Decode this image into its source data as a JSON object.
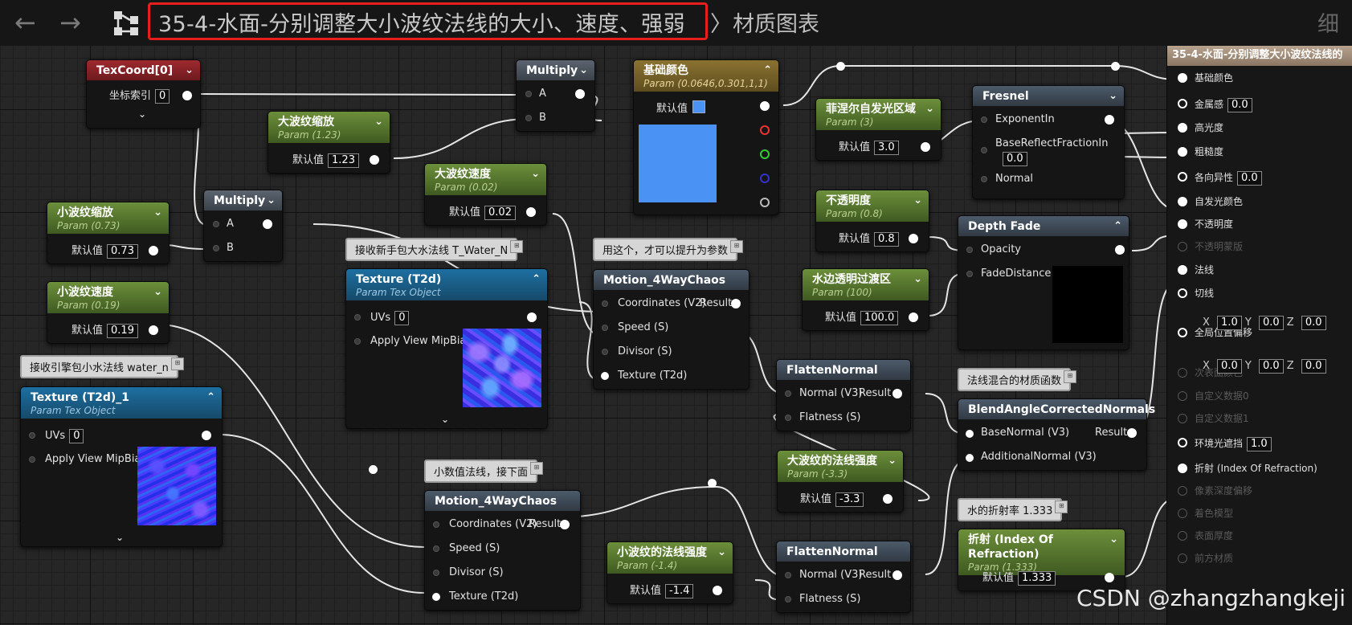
{
  "toolbar": {
    "back_arrow": "←",
    "forward_arrow": "→",
    "graph_title": "35-4-水面-分别调整大小波纹法线的大小、速度、强弱",
    "breadcrumb_separator": "〉",
    "breadcrumb_next": "材质图表",
    "breadcrumb_tail": "细"
  },
  "nodes": {
    "texcoord": {
      "title": "TexCoord[0]",
      "row_label": "坐标索引",
      "value": "0"
    },
    "multiply1": {
      "title": "Multiply",
      "pin_a": "A",
      "pin_b": "B"
    },
    "multiply2": {
      "title": "Multiply",
      "pin_a": "A",
      "pin_b": "B"
    },
    "big_ripple_scale": {
      "title": "大波纹缩放",
      "subtitle": "Param (1.23)",
      "label": "默认值",
      "value": "1.23"
    },
    "big_ripple_speed": {
      "title": "大波纹速度",
      "subtitle": "Param (0.02)",
      "label": "默认值",
      "value": "0.02"
    },
    "small_ripple_scale": {
      "title": "小波纹缩放",
      "subtitle": "Param (0.73)",
      "label": "默认值",
      "value": "0.73"
    },
    "small_ripple_speed": {
      "title": "小波纹速度",
      "subtitle": "Param (0.19)",
      "label": "默认值",
      "value": "0.19"
    },
    "base_color": {
      "title": "基础颜色",
      "subtitle": "Param (0.0646,0.301,1,1)",
      "label": "默认值",
      "color": "#4a93f5"
    },
    "fresnel_emissive": {
      "title": "菲涅尔自发光区域",
      "subtitle": "Param (3)",
      "label": "默认值",
      "value": "3.0"
    },
    "opacity_param": {
      "title": "不透明度",
      "subtitle": "Param (0.8)",
      "label": "默认值",
      "value": "0.8"
    },
    "shore_transition": {
      "title": "水边透明过渡区",
      "subtitle": "Param (100)",
      "label": "默认值",
      "value": "100.0"
    },
    "fresnel": {
      "title": "Fresnel",
      "pin1": "ExponentIn",
      "pin2": "BaseReflectFractionIn",
      "pin2_value": "0.0",
      "pin3": "Normal"
    },
    "depth_fade": {
      "title": "Depth Fade",
      "pin1": "Opacity",
      "pin2": "FadeDistance"
    },
    "texture_t2d": {
      "title": "Texture (T2d)",
      "subtitle": "Param Tex Object",
      "pin1": "UVs",
      "pin1_value": "0",
      "pin2": "Apply View MipBias"
    },
    "texture_t2d_1": {
      "title": "Texture (T2d)_1",
      "subtitle": "Param Tex Object",
      "pin1": "UVs",
      "pin1_value": "0",
      "pin2": "Apply View MipBias"
    },
    "motion1": {
      "title": "Motion_4WayChaos",
      "pin1": "Coordinates (V2)",
      "result": "Result",
      "pin2": "Speed (S)",
      "pin3": "Divisor (S)",
      "pin4": "Texture (T2d)"
    },
    "motion2": {
      "title": "Motion_4WayChaos",
      "pin1": "Coordinates (V2)",
      "result": "Result",
      "pin2": "Speed (S)",
      "pin3": "Divisor (S)",
      "pin4": "Texture (T2d)"
    },
    "flatten1": {
      "title": "FlattenNormal",
      "pin1": "Normal (V3)",
      "result": "Result",
      "pin2": "Flatness (S)"
    },
    "flatten2": {
      "title": "FlattenNormal",
      "pin1": "Normal (V3)",
      "result": "Result",
      "pin2": "Flatness (S)"
    },
    "big_normal_strength": {
      "title": "大波纹的法线强度",
      "subtitle": "Param (-3.3)",
      "label": "默认值",
      "value": "-3.3"
    },
    "small_normal_strength": {
      "title": "小波纹的法线强度",
      "subtitle": "Param (-1.4)",
      "label": "默认值",
      "value": "-1.4"
    },
    "blend_normals": {
      "title": "BlendAngleCorrectedNormals",
      "pin1": "BaseNormal (V3)",
      "result": "Result",
      "pin2": "AdditionalNormal (V3)"
    },
    "refraction": {
      "title": "折射 (Index Of Refraction)",
      "subtitle": "Param (1.333)",
      "label": "默认值",
      "value": "1.333"
    }
  },
  "comments": {
    "c_new_water": "接收新手包大水法线 T_Water_N",
    "c_engine_water": "接收引擎包小水法线 water_n",
    "c_use_this": "用这个，才可以提升为参数",
    "c_small_normal": "小数值法线，接下面",
    "c_blend_func": "法线混合的材质函数",
    "c_ior": "水的折射率 1.333"
  },
  "result_node": {
    "title": "35-4-水面-分别调整大小波纹法线的",
    "pins": [
      {
        "label": "基础颜色",
        "state": "on"
      },
      {
        "label": "金属感",
        "state": "ho",
        "value": "0.0"
      },
      {
        "label": "高光度",
        "state": "on"
      },
      {
        "label": "粗糙度",
        "state": "on"
      },
      {
        "label": "各向异性",
        "state": "ho",
        "value": "0.0"
      },
      {
        "label": "自发光颜色",
        "state": "on"
      },
      {
        "label": "不透明度",
        "state": "on"
      },
      {
        "label": "不透明蒙版",
        "state": "off"
      },
      {
        "label": "法线",
        "state": "on"
      },
      {
        "label": "切线",
        "state": "ho"
      },
      {
        "label": "全局位置偏移",
        "state": "ho"
      },
      {
        "label": "次表面颜色",
        "state": "off"
      },
      {
        "label": "自定义数据0",
        "state": "off"
      },
      {
        "label": "自定义数据1",
        "state": "off"
      },
      {
        "label": "环境光遮挡",
        "state": "ho",
        "value": "1.0"
      },
      {
        "label": "折射 (Index Of Refraction)",
        "state": "on"
      },
      {
        "label": "像素深度偏移",
        "state": "off"
      },
      {
        "label": "着色模型",
        "state": "off"
      },
      {
        "label": "表面厚度",
        "state": "off"
      },
      {
        "label": "前方材质",
        "state": "off"
      }
    ],
    "tangent_xyz": {
      "x_label": "X",
      "x": "1.0",
      "y_label": "Y",
      "y": "0.0",
      "z_label": "Z",
      "z": "0.0"
    },
    "wpo_xyz": {
      "x_label": "X",
      "x": "0.0",
      "y_label": "Y",
      "y": "0.0",
      "z_label": "Z",
      "z": "0.0"
    }
  },
  "watermark": "CSDN @zhangzhangkeji"
}
